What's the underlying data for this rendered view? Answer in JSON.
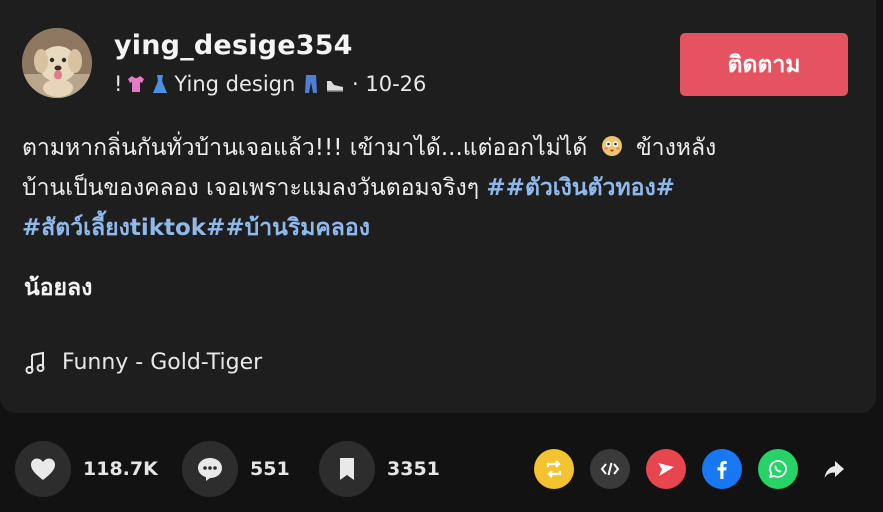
{
  "post": {
    "username": "ying_desige354",
    "subline_prefix": "!",
    "subline_name": "Ying design",
    "subline_sep": " · ",
    "date": "10-26",
    "follow_label": "ติดตาม",
    "caption_line1_a": "ตามหากลิ่นกันทั่วบ้านเจอแล้ว!!! เข้ามาได้...แต่ออกไม่ได้",
    "caption_line1_b": "ข้างหลัง",
    "caption_line2_text": "บ้านเป็นของคลอง เจอเพราะแมลงวันตอมจริงๆ ",
    "hashtags": [
      "##ตัวเงินตัวทอง#",
      "#สัตว์เลี้ยงtiktok#",
      "#บ้านริมคลอง"
    ],
    "less_label": "น้อยลง",
    "music": "Funny - Gold-Tiger"
  },
  "actions": {
    "likes": "118.7K",
    "comments": "551",
    "saves": "3351"
  },
  "share": {
    "repost_color": "#f4c430",
    "embed_color": "#3a3a3b",
    "send_color": "#e8464f",
    "facebook_color": "#1877f2",
    "whatsapp_color": "#25d366"
  }
}
